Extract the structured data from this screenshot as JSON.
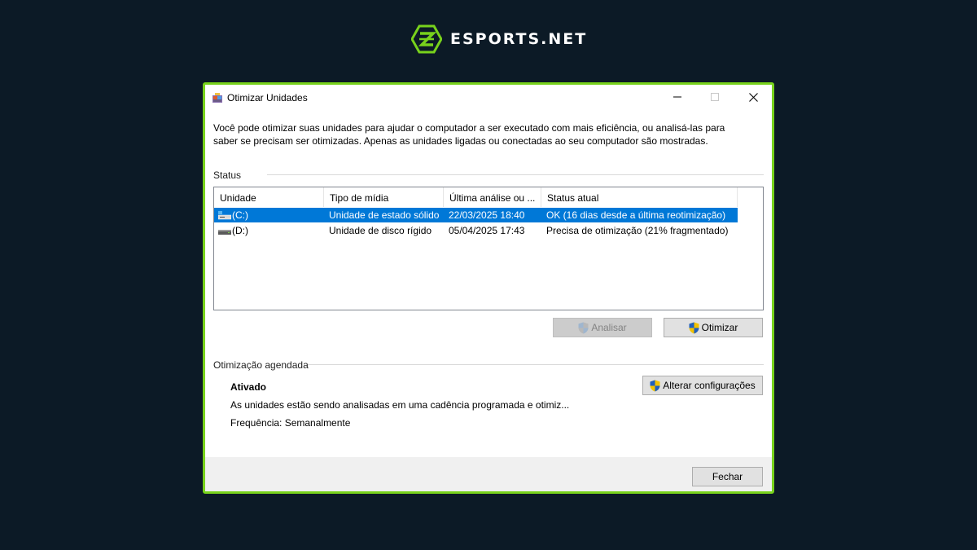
{
  "brand": {
    "name": "ESPORTS.NET",
    "accent": "#78d21c"
  },
  "window": {
    "title": "Otimizar Unidades",
    "controls": {
      "minimize": "minimize-icon",
      "maximize": "maximize-icon",
      "close": "close-icon"
    }
  },
  "description": "Você pode otimizar suas unidades para ajudar o computador a ser executado com mais eficiência, ou analisá-las para saber se precisam ser otimizadas. Apenas as unidades ligadas ou conectadas ao seu computador são mostradas.",
  "status": {
    "label": "Status",
    "columns": [
      "Unidade",
      "Tipo de mídia",
      "Última análise ou ...",
      "Status atual"
    ],
    "rows": [
      {
        "drive": "(C:)",
        "icon": "ssd-drive-icon",
        "media": "Unidade de estado sólido",
        "last": "22/03/2025 18:40",
        "state": "OK (16 dias desde a última reotimização)",
        "selected": true
      },
      {
        "drive": "(D:)",
        "icon": "hdd-drive-icon",
        "media": "Unidade de disco rígido",
        "last": "05/04/2025 17:43",
        "state": "Precisa de otimização (21% fragmentado)",
        "selected": false
      }
    ]
  },
  "buttons": {
    "analyze": "Analisar",
    "optimize": "Otimizar",
    "change_settings": "Alterar configurações",
    "close": "Fechar"
  },
  "schedule": {
    "label": "Otimização agendada",
    "state": "Ativado",
    "detail": "As unidades estão sendo analisadas em uma cadência programada e otimiz...",
    "frequency": "Frequência: Semanalmente"
  }
}
